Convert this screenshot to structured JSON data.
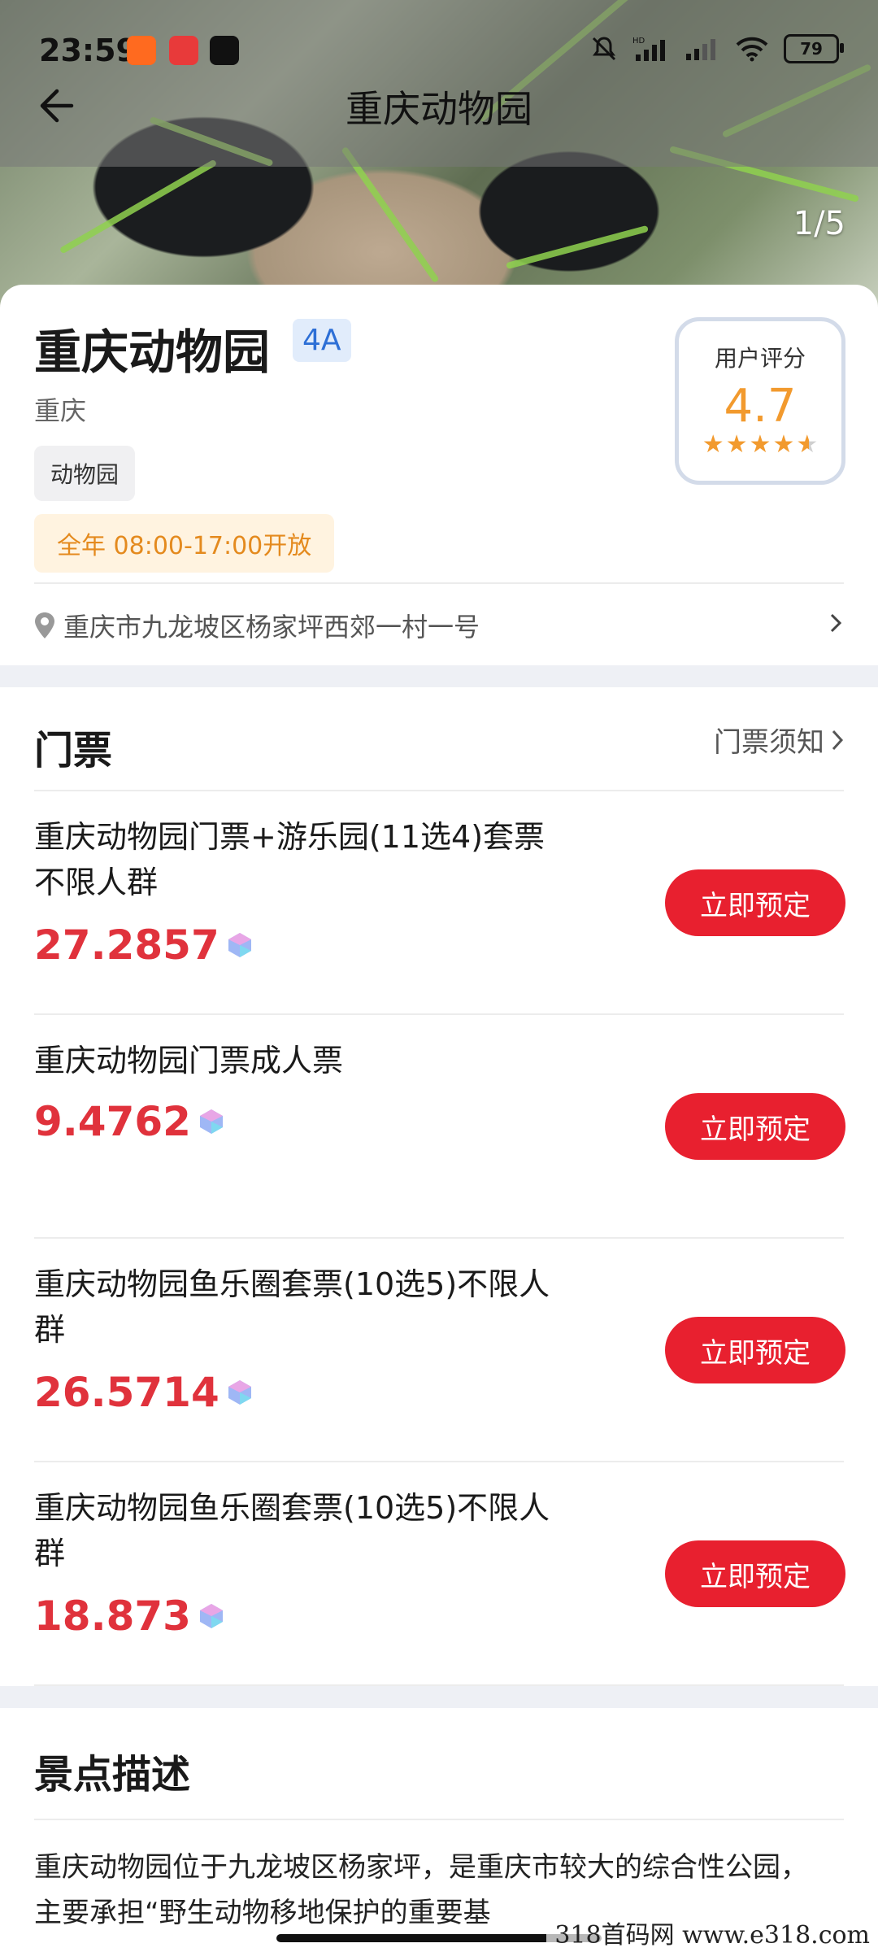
{
  "status_bar": {
    "time": "23:59",
    "battery": "79",
    "icons": [
      "kuaishou-icon",
      "kankan-icon",
      "tiktok-icon",
      "mute-icon",
      "hd-signal-icon",
      "signal-icon",
      "wifi-icon",
      "battery-icon"
    ]
  },
  "header": {
    "title": "重庆动物园",
    "image_counter": "1/5"
  },
  "attraction": {
    "name": "重庆动物园",
    "level": "4A",
    "city": "重庆",
    "category": "动物园",
    "hours": "全年 08:00-17:00开放",
    "address": "重庆市九龙坡区杨家坪西郊一村一号",
    "rating_label": "用户评分",
    "rating_score": "4.7",
    "rating_stars": 4.7
  },
  "tickets": {
    "title": "门票",
    "notice_label": "门票须知",
    "book_label": "立即预定",
    "items": [
      {
        "name": "重庆动物园门票+游乐园(11选4)套票不限人群",
        "price": "27.2857"
      },
      {
        "name": "重庆动物园门票成人票",
        "price": "9.4762"
      },
      {
        "name": "重庆动物园鱼乐圈套票(10选5)不限人群",
        "price": "26.5714"
      },
      {
        "name": "重庆动物园鱼乐圈套票(10选5)不限人群",
        "price": "18.873"
      }
    ]
  },
  "description": {
    "title": "景点描述",
    "text": "重庆动物园位于九龙坡区杨家坪，是重庆市较大的综合性公园，主要承担“野生动物移地保护的重要基"
  },
  "watermark": "318首码网   www.e318.com",
  "colors": {
    "accent_red": "#e8202f",
    "price_red": "#e0323c",
    "rating_orange": "#f29a2e",
    "badge_blue": "#2d6fd6"
  }
}
